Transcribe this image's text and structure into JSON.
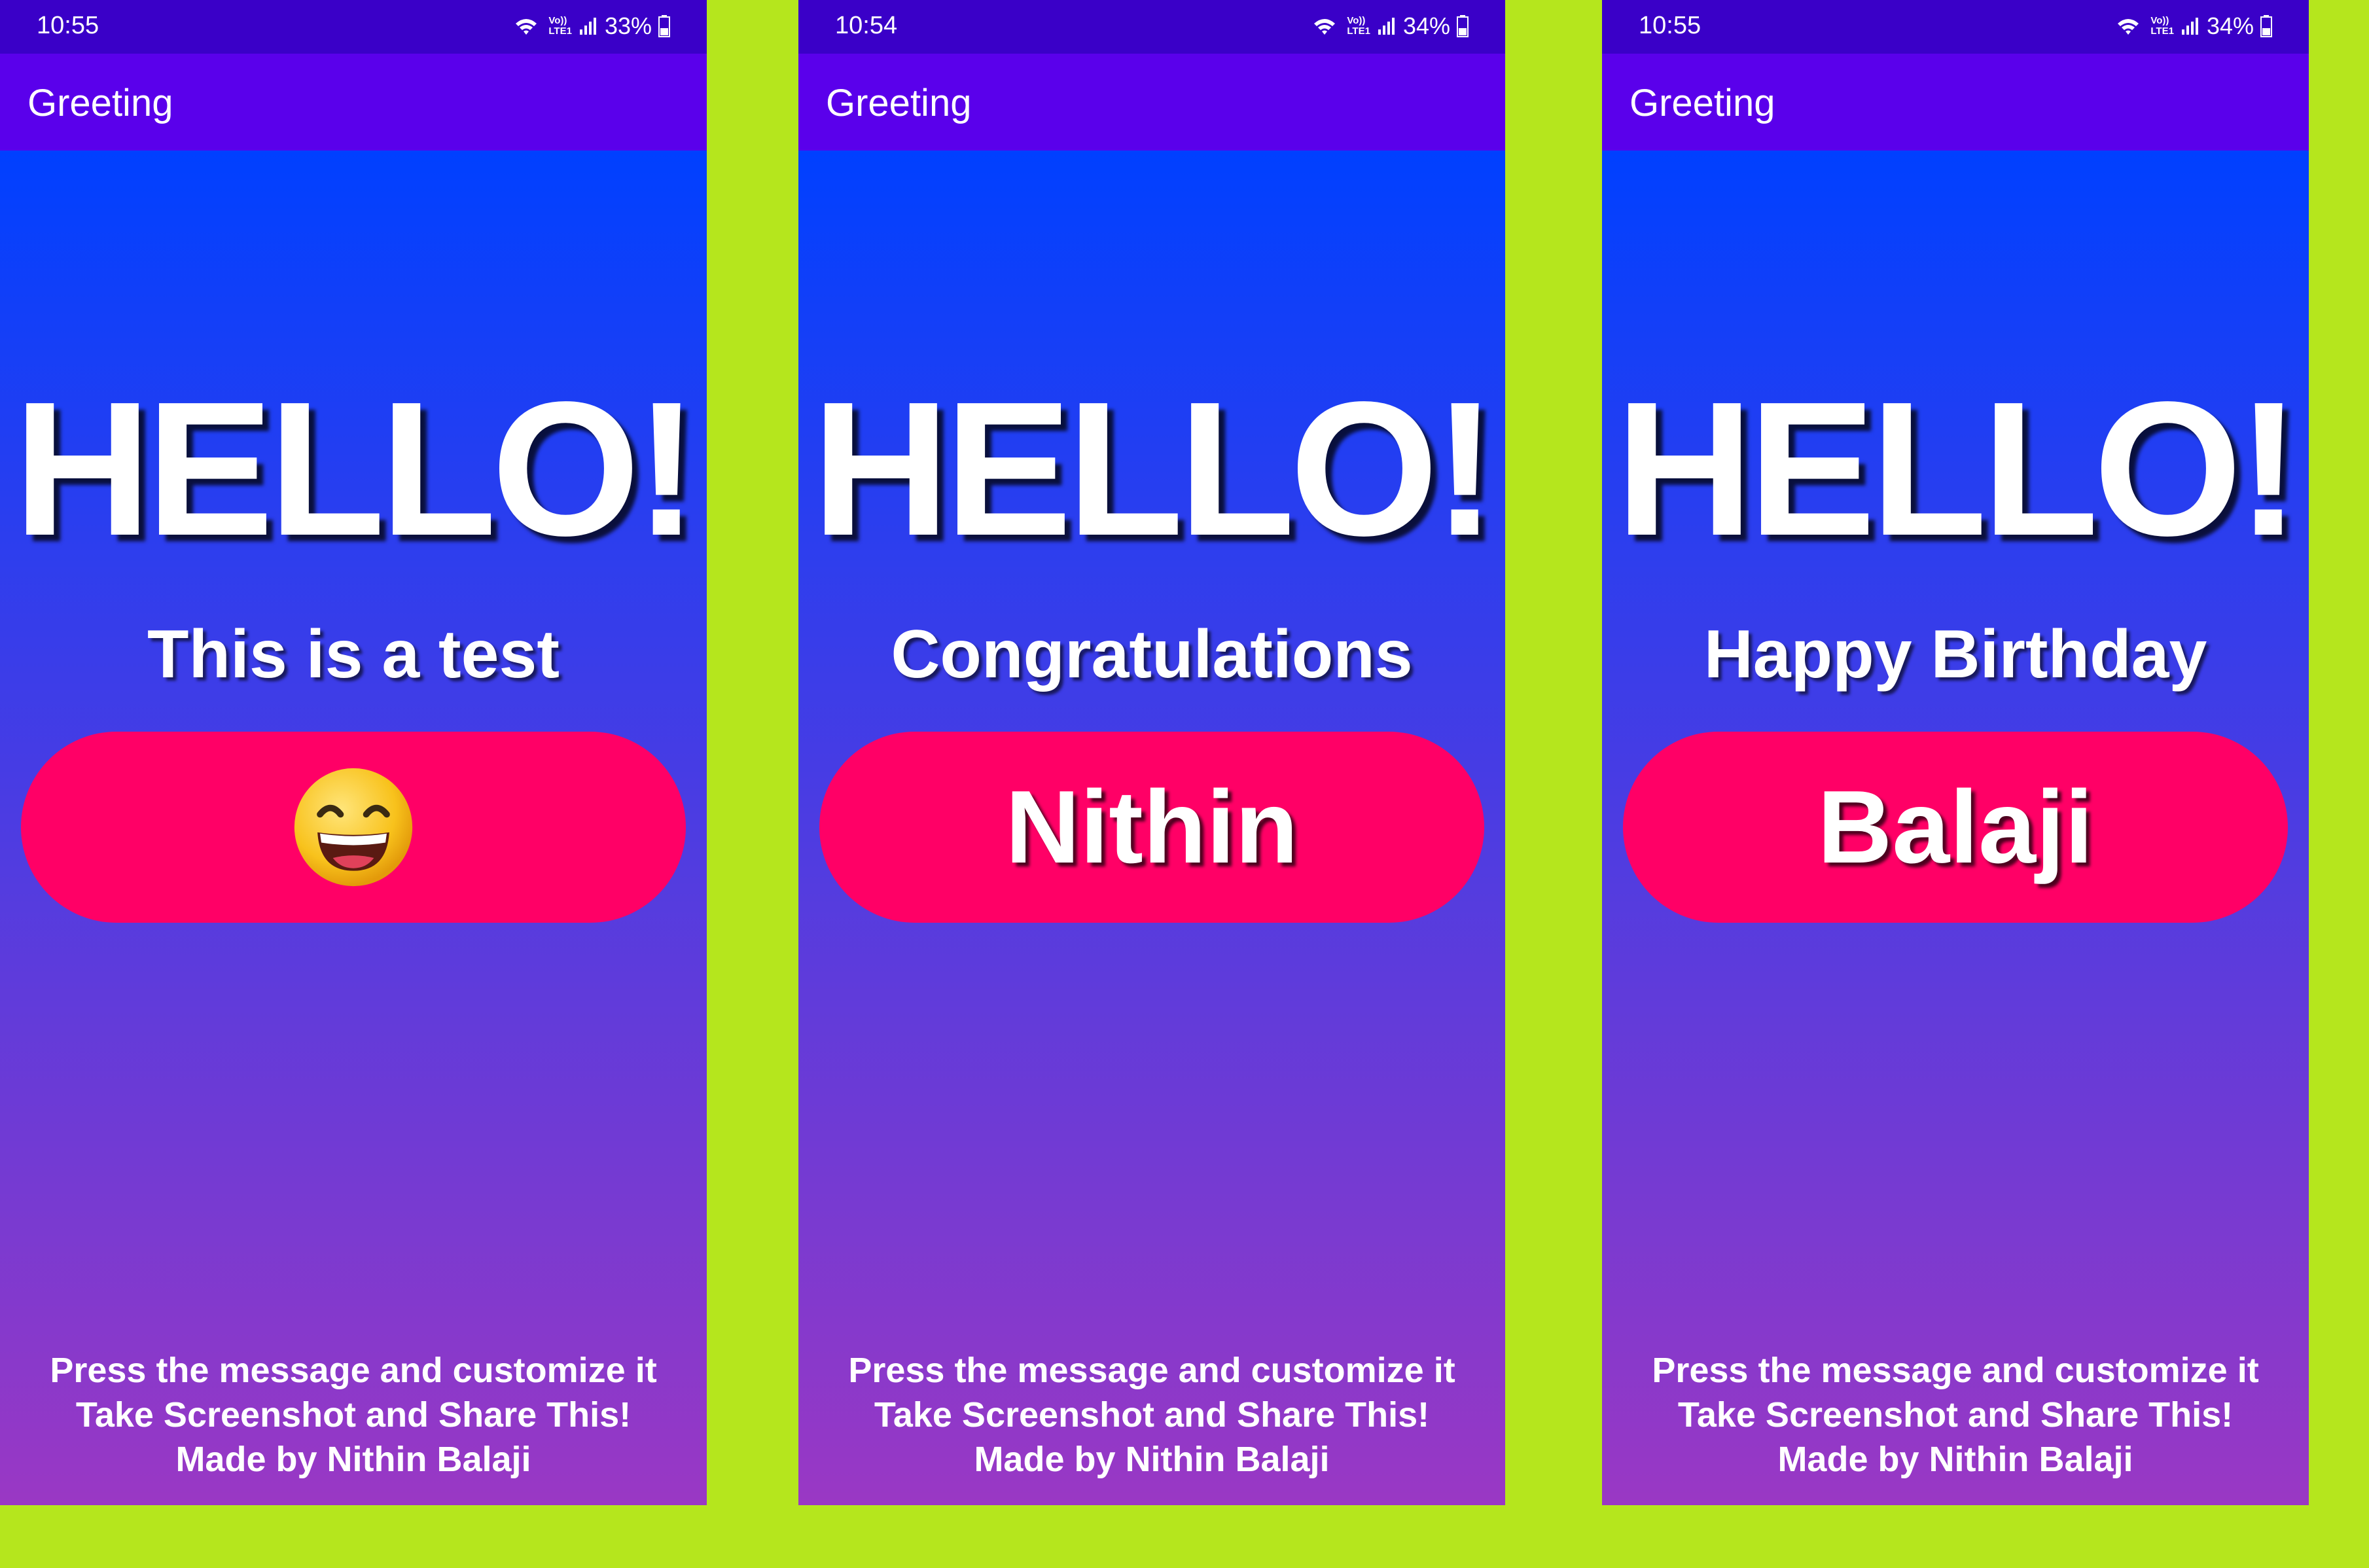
{
  "phones": [
    {
      "status": {
        "time": "10:55",
        "net_top": "Vo))",
        "net_bottom": "LTE1",
        "battery": "33%"
      },
      "app_title": "Greeting",
      "hello": "HELLO!",
      "subtitle": "This is a test",
      "pill_text": "",
      "pill_icon": "grinning-face-emoji",
      "footer": [
        "Press the message and customize it",
        "Take Screenshot and Share This!",
        "Made by Nithin Balaji"
      ]
    },
    {
      "status": {
        "time": "10:54",
        "net_top": "Vo))",
        "net_bottom": "LTE1",
        "battery": "34%"
      },
      "app_title": "Greeting",
      "hello": "HELLO!",
      "subtitle": "Congratulations",
      "pill_text": "Nithin",
      "footer": [
        "Press the message and customize it",
        "Take Screenshot and Share This!",
        "Made by Nithin Balaji"
      ]
    },
    {
      "status": {
        "time": "10:55",
        "net_top": "Vo))",
        "net_bottom": "LTE1",
        "battery": "34%"
      },
      "app_title": "Greeting",
      "hello": "HELLO!",
      "subtitle": "Happy Birthday",
      "pill_text": "Balaji",
      "footer": [
        "Press the message and customize it",
        "Take Screenshot and Share This!",
        "Made by Nithin Balaji"
      ]
    }
  ],
  "colors": {
    "outer_background": "#b5e61d",
    "status_bar": "#3a00c8",
    "app_bar": "#5a00eb",
    "gradient_top": "#0040ff",
    "gradient_bottom": "#9a38c4",
    "pill": "#ff0066",
    "text": "#ffffff"
  }
}
